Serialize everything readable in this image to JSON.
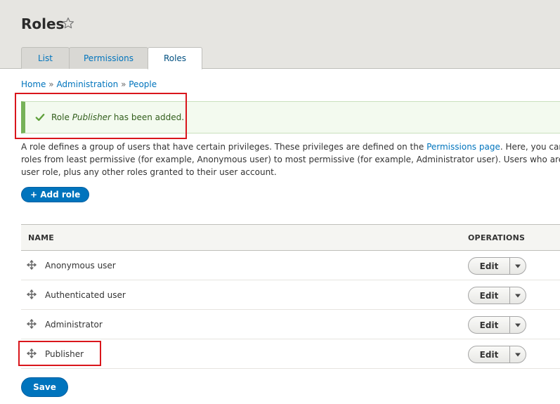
{
  "header": {
    "title": "Roles",
    "tabs": [
      {
        "label": "List",
        "active": false
      },
      {
        "label": "Permissions",
        "active": false
      },
      {
        "label": "Roles",
        "active": true
      }
    ]
  },
  "breadcrumb": {
    "items": [
      "Home",
      "Administration",
      "People"
    ],
    "separator": "»"
  },
  "status": {
    "prefix": "Role",
    "role": "Publisher",
    "suffix": "has been added."
  },
  "description": {
    "line1_before": "A role defines a group of users that have certain privileges. These privileges are defined on the",
    "link": "Permissions page",
    "line1_after": ". Here, you can define",
    "line2": "roles from least permissive (for example, Anonymous user) to most permissive (for example, Administrator user). Users who are not lo",
    "line3": "user role, plus any other roles granted to their user account."
  },
  "actions": {
    "add_role": "+ Add role",
    "save": "Save"
  },
  "table": {
    "columns": [
      "NAME",
      "OPERATIONS"
    ],
    "rows": [
      {
        "name": "Anonymous user",
        "operation": "Edit"
      },
      {
        "name": "Authenticated user",
        "operation": "Edit"
      },
      {
        "name": "Administrator",
        "operation": "Edit"
      },
      {
        "name": "Publisher",
        "operation": "Edit"
      }
    ]
  },
  "colors": {
    "accent": "#0074bd",
    "success": "#77b259",
    "highlight": "#d9161c"
  },
  "icons": [
    "star-icon",
    "check-icon",
    "drag-icon",
    "chevron-down-icon"
  ]
}
